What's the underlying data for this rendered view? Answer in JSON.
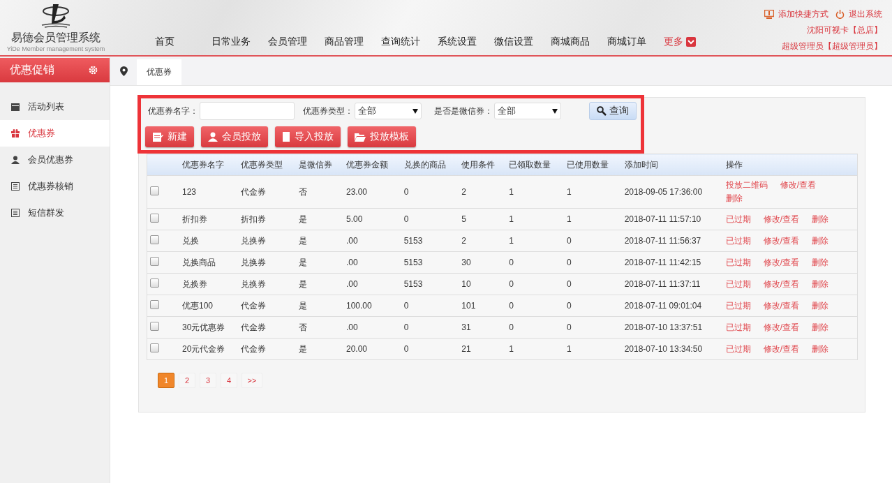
{
  "header": {
    "logo_title": "易德会员管理系统",
    "logo_subtitle": "YiDe Member management system",
    "nav": [
      {
        "label": "首页",
        "kind": "link"
      },
      {
        "label": "日常业务",
        "kind": "link"
      },
      {
        "label": "会员管理",
        "kind": "link"
      },
      {
        "label": "商品管理",
        "kind": "link"
      },
      {
        "label": "查询统计",
        "kind": "link"
      },
      {
        "label": "系统设置",
        "kind": "link"
      },
      {
        "label": "微信设置",
        "kind": "link"
      },
      {
        "label": "商城商品",
        "kind": "link"
      },
      {
        "label": "商城订单",
        "kind": "link"
      },
      {
        "label": "更多",
        "kind": "dropdown"
      }
    ],
    "shortcut": "添加快捷方式",
    "logout": "退出系统",
    "store": "沈阳可视卡【总店】",
    "user": "超级管理员【超级管理员】"
  },
  "sidebar": {
    "title": "优惠促销",
    "items": [
      {
        "label": "活动列表",
        "selected": false
      },
      {
        "label": "优惠券",
        "selected": true
      },
      {
        "label": "会员优惠券",
        "selected": false
      },
      {
        "label": "优惠券核销",
        "selected": false
      },
      {
        "label": "短信群发",
        "selected": false
      }
    ]
  },
  "breadcrumb": {
    "tab": "优惠券"
  },
  "filters": {
    "name_label": "优惠券名字：",
    "type_label": "优惠券类型：",
    "type_value": "全部",
    "wechat_label": "是否是微信券：",
    "wechat_value": "全部",
    "query": "查询"
  },
  "actions": [
    "新建",
    "会员投放",
    "导入投放",
    "投放模板"
  ],
  "table": {
    "columns": [
      "优惠券名字",
      "优惠券类型",
      "是微信券",
      "优惠券金额",
      "兑换的商品",
      "使用条件",
      "已领取数量",
      "已使用数量",
      "添加时间",
      "操作"
    ],
    "rows": [
      {
        "checked": false,
        "cells": [
          "123",
          "代金券",
          "否",
          "23.00",
          "0",
          "2",
          "1",
          "1",
          "2018-09-05 17:36:00"
        ],
        "ops": [
          "投放二维码",
          "修改/查看",
          "删除"
        ]
      },
      {
        "checked": false,
        "cells": [
          "折扣券",
          "折扣券",
          "是",
          "5.00",
          "0",
          "5",
          "1",
          "1",
          "2018-07-11 11:57:10"
        ],
        "ops": [
          "已过期",
          "修改/查看",
          "删除"
        ]
      },
      {
        "checked": false,
        "cells": [
          "兑换",
          "兑换券",
          "是",
          ".00",
          "5153",
          "2",
          "1",
          "0",
          "2018-07-11 11:56:37"
        ],
        "ops": [
          "已过期",
          "修改/查看",
          "删除"
        ]
      },
      {
        "checked": false,
        "cells": [
          "兑换商品",
          "兑换券",
          "是",
          ".00",
          "5153",
          "30",
          "0",
          "0",
          "2018-07-11 11:42:15"
        ],
        "ops": [
          "已过期",
          "修改/查看",
          "删除"
        ]
      },
      {
        "checked": false,
        "cells": [
          "兑换券",
          "兑换券",
          "是",
          ".00",
          "5153",
          "10",
          "0",
          "0",
          "2018-07-11 11:37:11"
        ],
        "ops": [
          "已过期",
          "修改/查看",
          "删除"
        ]
      },
      {
        "checked": false,
        "cells": [
          "优惠100",
          "代金券",
          "是",
          "100.00",
          "0",
          "101",
          "0",
          "0",
          "2018-07-11 09:01:04"
        ],
        "ops": [
          "已过期",
          "修改/查看",
          "删除"
        ]
      },
      {
        "checked": false,
        "cells": [
          "30元优惠券",
          "代金券",
          "否",
          ".00",
          "0",
          "31",
          "0",
          "0",
          "2018-07-10 13:37:51"
        ],
        "ops": [
          "已过期",
          "修改/查看",
          "删除"
        ]
      },
      {
        "checked": false,
        "cells": [
          "20元代金券",
          "代金券",
          "是",
          "20.00",
          "0",
          "21",
          "1",
          "1",
          "2018-07-10 13:34:50"
        ],
        "ops": [
          "已过期",
          "修改/查看",
          "删除"
        ]
      }
    ]
  },
  "pagination": [
    {
      "label": "1",
      "selected": true
    },
    {
      "label": "2",
      "selected": false
    },
    {
      "label": "3",
      "selected": false
    },
    {
      "label": "4",
      "selected": false
    },
    {
      "label": ">>",
      "selected": false
    }
  ]
}
